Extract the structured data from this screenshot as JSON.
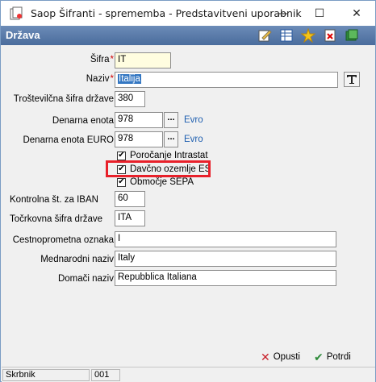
{
  "window": {
    "title": "Saop Šifranti - sprememba - Predstavitveni uporabnik",
    "minimize": "—",
    "maximize": "☐",
    "close": "✕"
  },
  "header": {
    "title": "Država",
    "toolbar_icons": [
      "edit-icon",
      "table-icon",
      "star-icon",
      "delete-icon",
      "book-icon"
    ]
  },
  "form": {
    "sifra": {
      "label": "Šifra",
      "required": "*",
      "value": "IT"
    },
    "naziv": {
      "label": "Naziv",
      "required": "*",
      "value": "Italija"
    },
    "trostevilcna": {
      "label": "Troštevilčna šifra države",
      "value": "380"
    },
    "denarna_enota": {
      "label": "Denarna enota",
      "value": "978",
      "button": "...",
      "link": "Evro"
    },
    "denarna_enota_euro": {
      "label": "Denarna enota EURO",
      "value": "978",
      "button": "...",
      "link": "Evro"
    },
    "checkboxes": [
      {
        "label": "Poročanje Intrastat",
        "checked": true
      },
      {
        "label": "Davčno ozemlje ES",
        "checked": true
      },
      {
        "label": "Območje SEPA",
        "checked": true
      }
    ],
    "kontrolna": {
      "label": "Kontrolna št. za  IBAN",
      "value": "60"
    },
    "trocrkovna": {
      "label": "Točrkovna šifra države",
      "value": "ITA"
    },
    "cestnoprometna": {
      "label": "Cestnoprometna oznaka",
      "value": "I"
    },
    "mednarodni": {
      "label": "Mednarodni naziv",
      "value": "Italy"
    },
    "domaci": {
      "label": "Domači naziv",
      "value": "Repubblica Italiana"
    }
  },
  "actions": {
    "cancel": "Opusti",
    "confirm": "Potrdi"
  },
  "status": {
    "user": "Skrbnik",
    "code": "001"
  },
  "colors": {
    "header_bg": "#5a7aa8",
    "highlight": "#e8202a",
    "link": "#1f5fb0"
  }
}
